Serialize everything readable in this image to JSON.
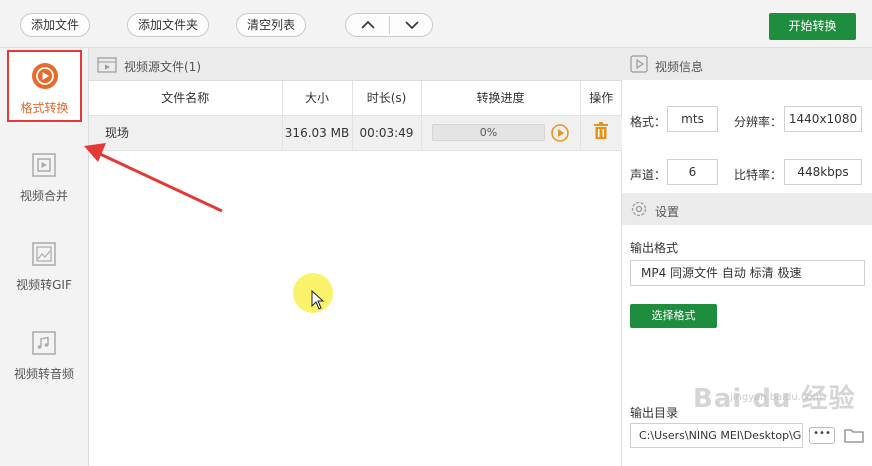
{
  "toolbar": {
    "add_file": "添加文件",
    "add_folder": "添加文件夹",
    "clear_list": "清空列表",
    "start": "开始转换"
  },
  "sidebar": {
    "items": [
      {
        "label": "格式转换",
        "icon": "format-convert-icon",
        "active": true
      },
      {
        "label": "视频合并",
        "icon": "video-merge-icon"
      },
      {
        "label": "视频转GIF",
        "icon": "video-to-gif-icon"
      },
      {
        "label": "视频转音频",
        "icon": "video-to-audio-icon"
      }
    ]
  },
  "source": {
    "title": "视频源文件(1)",
    "columns": [
      "文件名称",
      "大小",
      "时长(s)",
      "转换进度",
      "操作"
    ],
    "rows": [
      {
        "name": "现场",
        "size": "316.03 MB",
        "duration": "00:03:49",
        "progress": "0%"
      }
    ]
  },
  "video_info": {
    "title": "视频信息",
    "format_label": "格式：",
    "format": "mts",
    "resolution_label": "分辨率：",
    "resolution": "1440x1080",
    "channels_label": "声道：",
    "channels": "6",
    "bitrate_label": "比特率：",
    "bitrate": "448kbps"
  },
  "settings": {
    "title": "设置",
    "output_format_label": "输出格式",
    "output_format": "MP4 同源文件 自动 标清 极速",
    "choose_format": "选择格式",
    "output_dir_label": "输出目录",
    "output_dir": "C:\\Users\\NING MEI\\Desktop\\G",
    "browse": "•••"
  },
  "watermark": {
    "text": "Bai du 经验",
    "sub": "jingyan.baidu.com"
  },
  "colors": {
    "accent_green": "#1e8e3e",
    "accent_orange": "#e8692a",
    "highlight_red": "#e53935"
  }
}
